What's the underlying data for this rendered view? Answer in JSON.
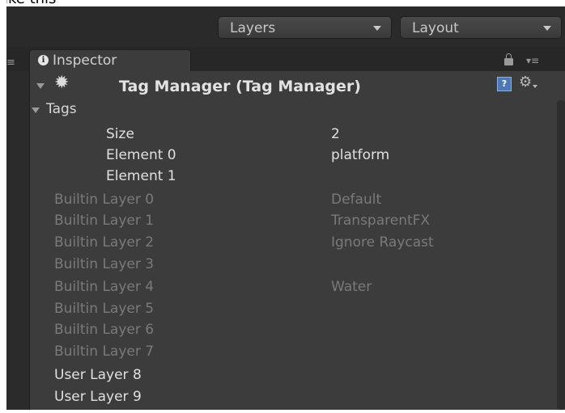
{
  "caption_fragment": "like this",
  "toolbar": {
    "layers_dropdown": "Layers",
    "layout_dropdown": "Layout"
  },
  "tab": {
    "label": "Inspector"
  },
  "header": {
    "title": "Tag Manager (Tag Manager)"
  },
  "tags": {
    "label": "Tags",
    "rows": [
      {
        "key": "Size",
        "value": "2"
      },
      {
        "key": "Element 0",
        "value": "platform"
      },
      {
        "key": "Element 1",
        "value": ""
      }
    ]
  },
  "builtin_layers": [
    {
      "key": "Builtin Layer 0",
      "value": "Default"
    },
    {
      "key": "Builtin Layer 1",
      "value": "TransparentFX"
    },
    {
      "key": "Builtin Layer 2",
      "value": "Ignore Raycast"
    },
    {
      "key": "Builtin Layer 3",
      "value": ""
    },
    {
      "key": "Builtin Layer 4",
      "value": "Water"
    },
    {
      "key": "Builtin Layer 5",
      "value": ""
    },
    {
      "key": "Builtin Layer 6",
      "value": ""
    },
    {
      "key": "Builtin Layer 7",
      "value": ""
    }
  ],
  "user_layers": [
    {
      "key": "User Layer 8",
      "value": ""
    },
    {
      "key": "User Layer 9",
      "value": ""
    }
  ],
  "colors": {
    "panel_bg": "#3c3c3c",
    "text_active": "#e0e0e0",
    "text_disabled": "#7a7a7a",
    "help_icon": "#4d78b8"
  },
  "icons": [
    "info-icon",
    "gear-icon",
    "help-icon",
    "settings-gear-icon",
    "lock-icon",
    "foldout-arrow-icon",
    "dropdown-arrow-icon"
  ]
}
